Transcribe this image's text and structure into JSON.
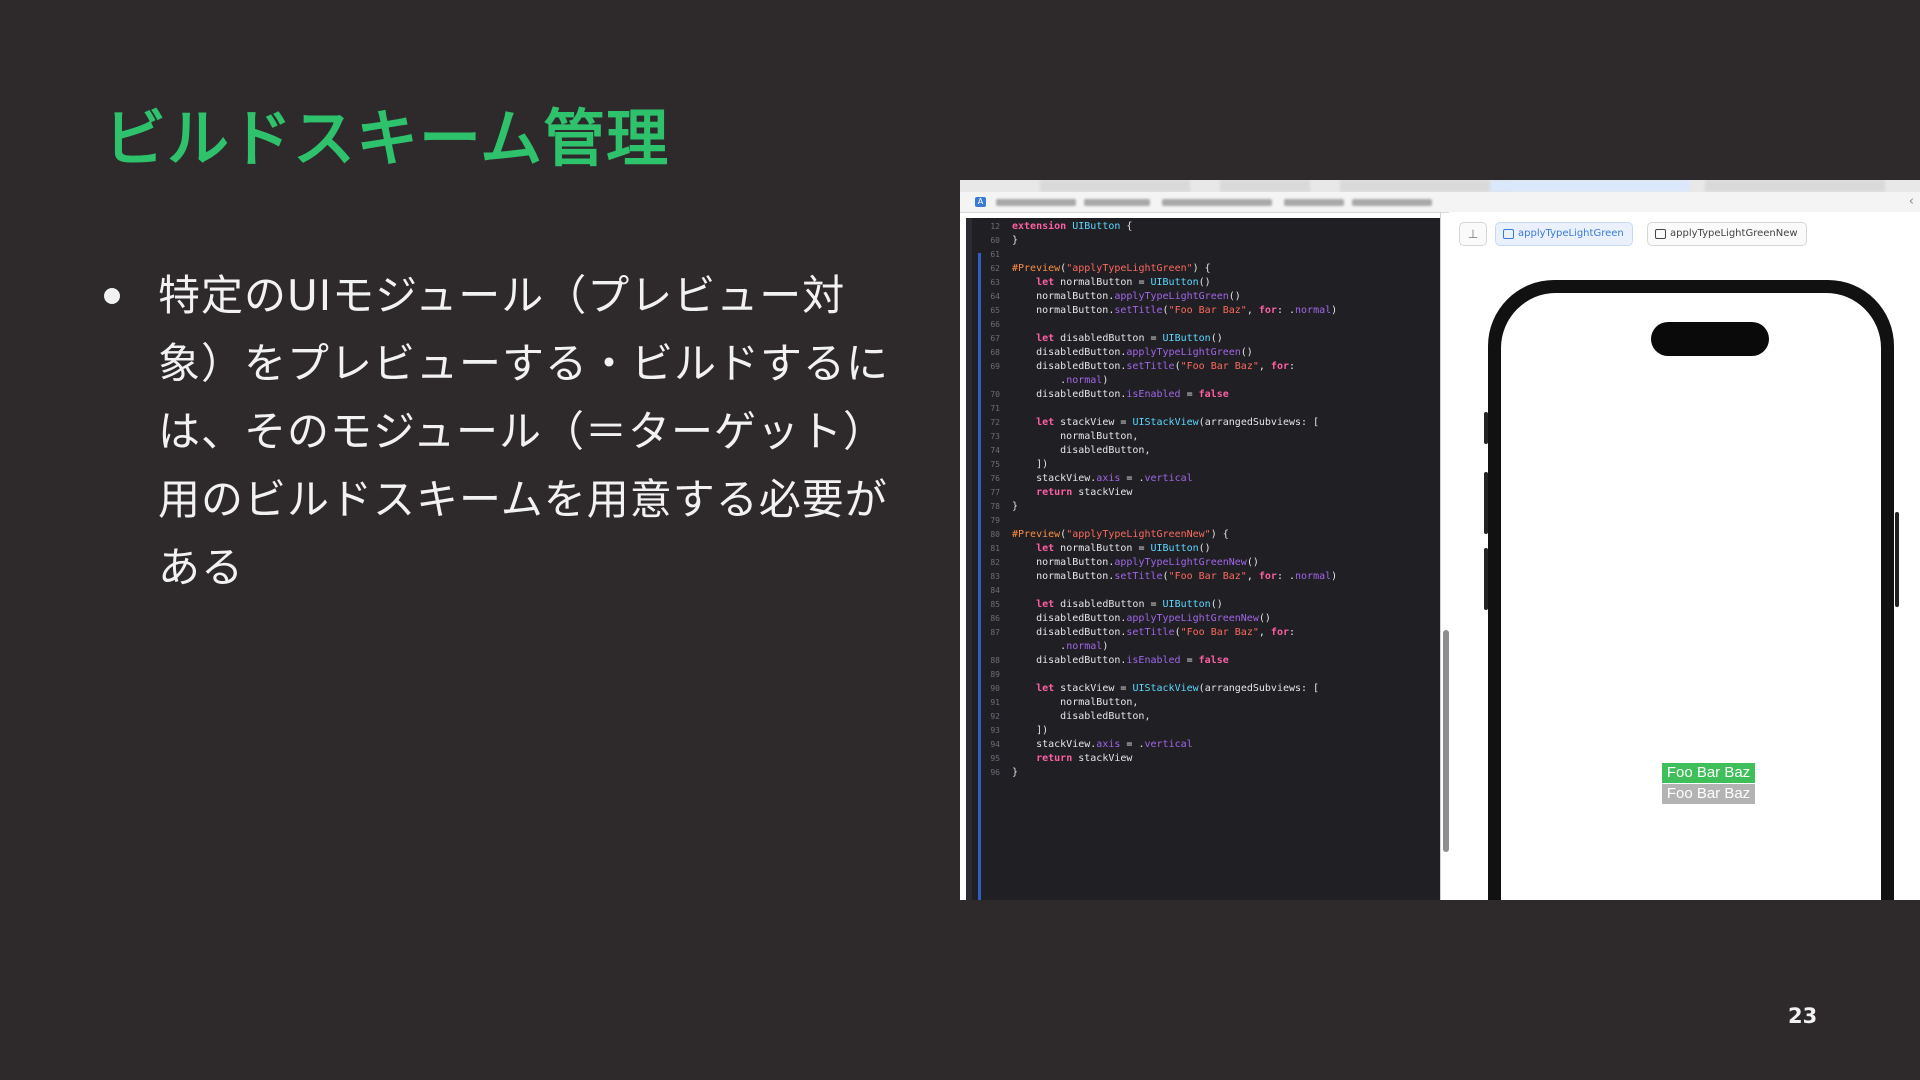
{
  "slide": {
    "title": "ビルドスキーム管理",
    "bullet": "特定のUIモジュール（プレビュー対象）をプレビューする・ビルドするには、そのモジュール（＝ターゲット）用のビルドスキームを用意する必要がある",
    "page_number": "23"
  },
  "screenshot": {
    "preview_chips": [
      "applyTypeLightGreen",
      "applyTypeLightGreenNew"
    ],
    "preview_buttons": {
      "normal": "Foo Bar Baz",
      "disabled": "Foo Bar Baz"
    },
    "colors": {
      "title": "#2ec26d",
      "button_normal": "#3fbf5a",
      "button_disabled": "#b3b3b3"
    },
    "code": [
      {
        "n": "12",
        "t": "extension UIButton {"
      },
      {
        "n": "60",
        "t": "}"
      },
      {
        "n": "61",
        "t": ""
      },
      {
        "n": "62",
        "t": "#Preview(\"applyTypeLightGreen\") {"
      },
      {
        "n": "63",
        "t": "    let normalButton = UIButton()"
      },
      {
        "n": "64",
        "t": "    normalButton.applyTypeLightGreen()"
      },
      {
        "n": "65",
        "t": "    normalButton.setTitle(\"Foo Bar Baz\", for: .normal)"
      },
      {
        "n": "66",
        "t": ""
      },
      {
        "n": "67",
        "t": "    let disabledButton = UIButton()"
      },
      {
        "n": "68",
        "t": "    disabledButton.applyTypeLightGreen()"
      },
      {
        "n": "69",
        "t": "    disabledButton.setTitle(\"Foo Bar Baz\", for:"
      },
      {
        "n": "",
        "t": "        .normal)"
      },
      {
        "n": "70",
        "t": "    disabledButton.isEnabled = false"
      },
      {
        "n": "71",
        "t": ""
      },
      {
        "n": "72",
        "t": "    let stackView = UIStackView(arrangedSubviews: ["
      },
      {
        "n": "73",
        "t": "        normalButton,"
      },
      {
        "n": "74",
        "t": "        disabledButton,"
      },
      {
        "n": "75",
        "t": "    ])"
      },
      {
        "n": "76",
        "t": "    stackView.axis = .vertical"
      },
      {
        "n": "77",
        "t": "    return stackView"
      },
      {
        "n": "78",
        "t": "}"
      },
      {
        "n": "79",
        "t": ""
      },
      {
        "n": "80",
        "t": "#Preview(\"applyTypeLightGreenNew\") {"
      },
      {
        "n": "81",
        "t": "    let normalButton = UIButton()"
      },
      {
        "n": "82",
        "t": "    normalButton.applyTypeLightGreenNew()"
      },
      {
        "n": "83",
        "t": "    normalButton.setTitle(\"Foo Bar Baz\", for: .normal)"
      },
      {
        "n": "84",
        "t": ""
      },
      {
        "n": "85",
        "t": "    let disabledButton = UIButton()"
      },
      {
        "n": "86",
        "t": "    disabledButton.applyTypeLightGreenNew()"
      },
      {
        "n": "87",
        "t": "    disabledButton.setTitle(\"Foo Bar Baz\", for:"
      },
      {
        "n": "",
        "t": "        .normal)"
      },
      {
        "n": "88",
        "t": "    disabledButton.isEnabled = false"
      },
      {
        "n": "89",
        "t": ""
      },
      {
        "n": "90",
        "t": "    let stackView = UIStackView(arrangedSubviews: ["
      },
      {
        "n": "91",
        "t": "        normalButton,"
      },
      {
        "n": "92",
        "t": "        disabledButton,"
      },
      {
        "n": "93",
        "t": "    ])"
      },
      {
        "n": "94",
        "t": "    stackView.axis = .vertical"
      },
      {
        "n": "95",
        "t": "    return stackView"
      },
      {
        "n": "96",
        "t": "}"
      }
    ]
  }
}
